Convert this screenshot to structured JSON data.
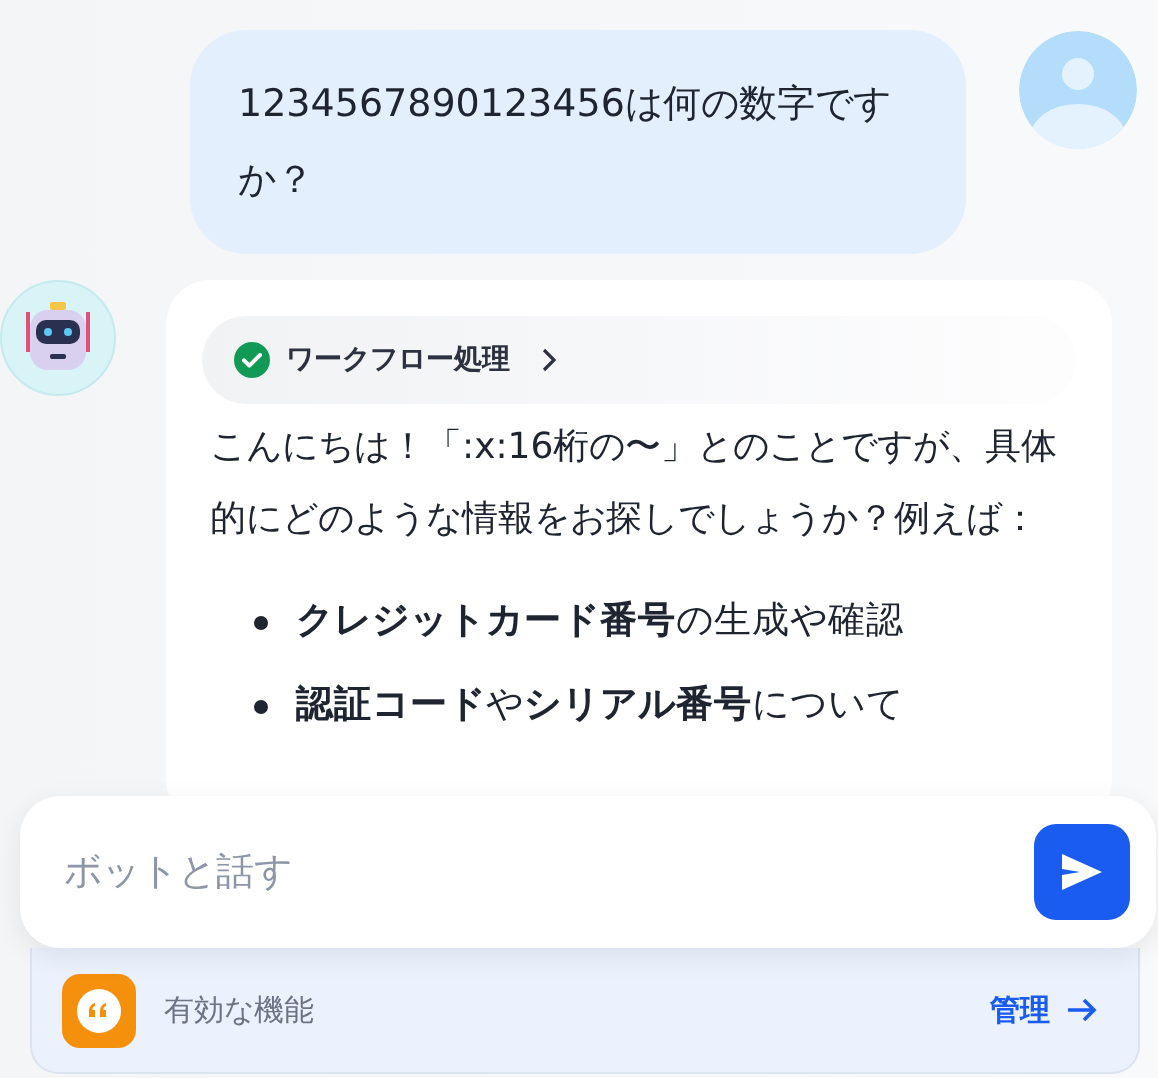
{
  "user_message": {
    "text": "1234567890123456は何の数字ですか？"
  },
  "bot_message": {
    "workflow": {
      "label": "ワークフロー処理"
    },
    "intro": "こんにちは！「:x:16桁の〜」とのことですが、具体的にどのような情報をお探しでしょうか？例えば：",
    "bullets": [
      "**クレジットカード番号**の生成や確認",
      "**認証コード**や**シリアル番号**について"
    ]
  },
  "composer": {
    "placeholder": "ボットと話す"
  },
  "features_bar": {
    "label": "有効な機能",
    "manage_link": "管理"
  }
}
